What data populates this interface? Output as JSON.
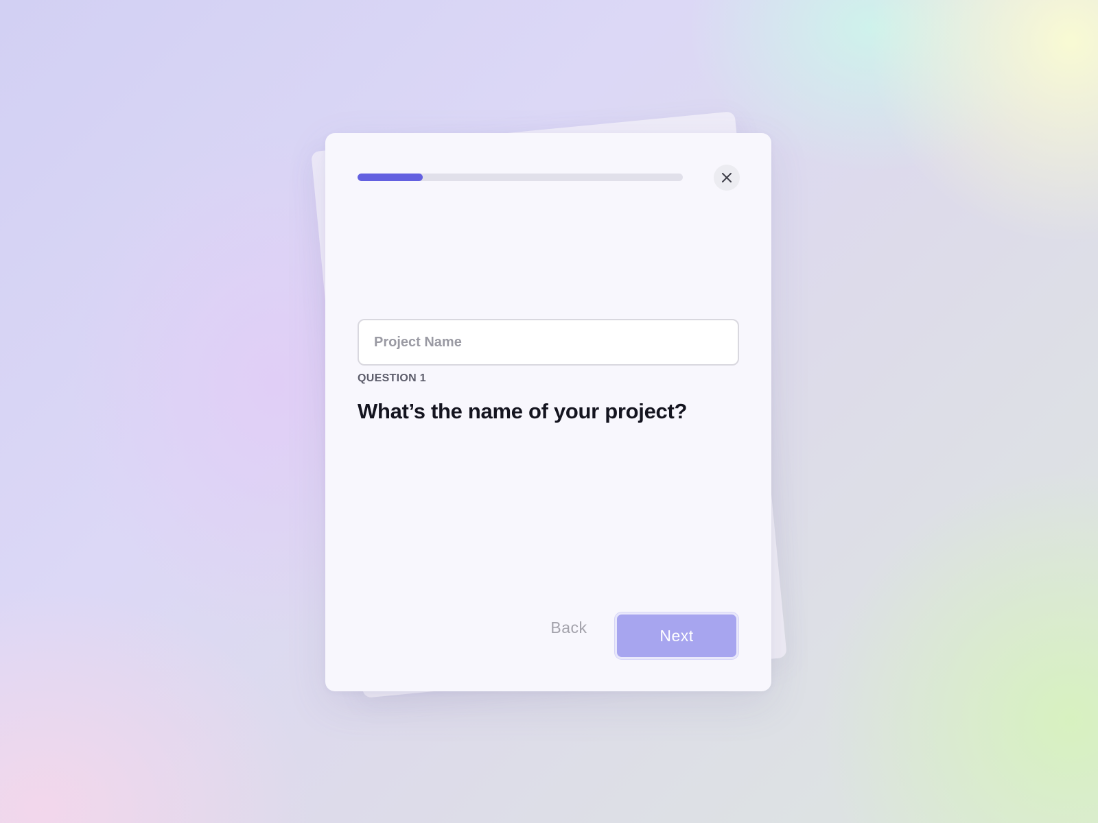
{
  "modal": {
    "progress": {
      "fraction": 0.2,
      "fill_color": "#6360e0",
      "track_color": "#e1e0ea"
    },
    "close_icon": "close-icon",
    "question_label": "QUESTION 1",
    "question_title": "What’s the name of your project?",
    "input": {
      "placeholder": "Project Name",
      "value": ""
    },
    "back_label": "Back",
    "next_label": "Next"
  },
  "colors": {
    "accent": "#6360e0",
    "next_button": "#a7a5ef"
  }
}
